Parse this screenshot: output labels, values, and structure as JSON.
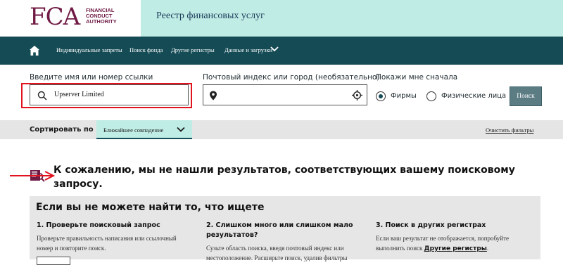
{
  "header": {
    "logo_mark": "FCA",
    "logo_lines": [
      "FINANCIAL",
      "CONDUCT",
      "AUTHORITY"
    ],
    "site_title": "Реестр финансовых услуг"
  },
  "nav": {
    "items": [
      {
        "label": "Индивидуальные запреты"
      },
      {
        "label": "Поиск фонда"
      },
      {
        "label": "Другие регистры"
      },
      {
        "label": "Данные и загрузки"
      }
    ]
  },
  "search": {
    "name_label": "Введите имя или номер ссылки",
    "name_value": "Upserver Limited",
    "location_label": "Почтовый индекс или город (необязательно)",
    "location_value": "",
    "show_first_label": "Покажи мне сначала",
    "options": [
      {
        "label": "Фирмы",
        "selected": true
      },
      {
        "label": "Физические лица",
        "selected": false
      }
    ],
    "button_label": "Поиск"
  },
  "sort": {
    "label": "Сортировать по",
    "selected": "Ближайшее совпадение",
    "clear_filters": "Очистить фильтры"
  },
  "results": {
    "no_results_message": "К сожалению, мы не нашли результатов, соответствующих вашему поисковому запросу."
  },
  "help": {
    "title": "Если вы не можете найти то, что ищете",
    "columns": [
      {
        "title": "1. Проверьте поисковый запрос",
        "text": "Проверьте правильность написания или ссылочный номер и повторите поиск."
      },
      {
        "title": "2. Слишком много или слишком мало результатов?",
        "text": "Сузьте область поиска, введя почтовый индекс или местоположение. Расширьте поиск, удалив фильтры"
      },
      {
        "title": "3. Поиск в других регистрах",
        "text_before": "Если ваш результат не отображается, попробуйте выполнить поиск",
        "link": "Другие регистры",
        "text_after": "."
      }
    ]
  },
  "colors": {
    "brand": "#701b45",
    "nav_bg": "#144b55",
    "header_band": "#bfece4",
    "annotation_red": "#e0131f"
  }
}
